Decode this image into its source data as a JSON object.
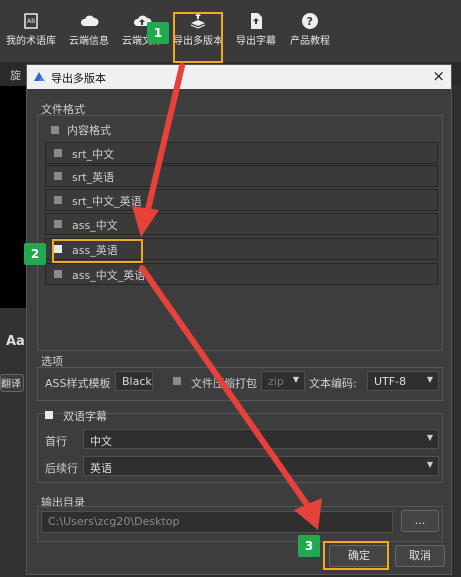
{
  "toolbar": {
    "items": [
      {
        "label": "我的术语库"
      },
      {
        "label": "云端信息"
      },
      {
        "label": "云端文件"
      },
      {
        "label": "导出多版本"
      },
      {
        "label": "导出字幕"
      },
      {
        "label": "产品教程"
      }
    ]
  },
  "background": {
    "tab_label": "旋",
    "aa_label": "Aa",
    "translate_label": "翻译"
  },
  "dialog": {
    "title": "导出多版本",
    "close": "×",
    "file_format_label": "文件格式",
    "content_format_label": "内容格式",
    "formats": [
      {
        "label": "srt_中文",
        "checked": false
      },
      {
        "label": "srt_英语",
        "checked": false
      },
      {
        "label": "srt_中文_英语",
        "checked": false
      },
      {
        "label": "ass_中文",
        "checked": false
      },
      {
        "label": "ass_英语",
        "checked": true
      },
      {
        "label": "ass_中文_英语",
        "checked": false
      }
    ],
    "options_label": "选项",
    "ass_template_label": "ASS样式模板",
    "ass_template_value": "Black",
    "compress_label": "文件压缩打包",
    "compress_value": "zip",
    "encoding_label": "文本编码:",
    "encoding_value": "UTF-8",
    "bilingual_label": "双语字幕",
    "first_line_label": "首行",
    "first_line_value": "中文",
    "next_line_label": "后续行",
    "next_line_value": "英语",
    "output_dir_label": "输出目录",
    "output_dir_value": "C:\\Users\\zcg20\\Desktop",
    "browse_label": "...",
    "ok_label": "确定",
    "cancel_label": "取消"
  },
  "annotations": {
    "badges": [
      "1",
      "2",
      "3"
    ],
    "colors": {
      "highlight": "#f2a91f",
      "arrow": "#e8413c",
      "badge": "#22a84f"
    }
  }
}
